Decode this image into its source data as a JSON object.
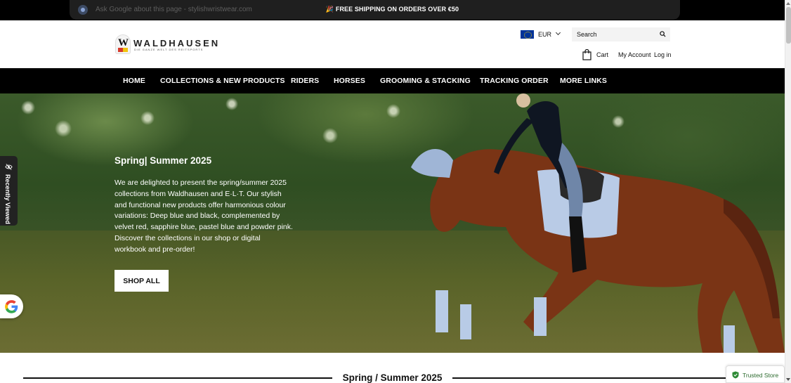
{
  "announcement": {
    "text": "🎉 FREE SHIPPING ON ORDERS OVER €50",
    "google_overlay": "Ask Google about this page - stylishwristwear.com"
  },
  "header": {
    "logo_word": "WALDHAUSEN",
    "logo_tagline": "DIE GANZE WELT DES REITSPORTS",
    "currency": "EUR",
    "search_placeholder": "Search",
    "cart_label": "Cart",
    "account_label": "My Account",
    "login_label": "Log in"
  },
  "nav": {
    "items": [
      {
        "label": "HOME"
      },
      {
        "label": "COLLECTIONS & NEW PRODUCTS"
      },
      {
        "label": "RIDERS"
      },
      {
        "label": "HORSES"
      },
      {
        "label": "GROOMING & STACKING"
      },
      {
        "label": "TRACKING ORDER"
      },
      {
        "label": "MORE LINKS"
      }
    ]
  },
  "hero": {
    "title": "Spring| Summer 2025",
    "body": "We are delighted to present the spring/summer 2025 collections from Waldhausen and E·L·T. Our stylish and functional new products offer harmonious colour variations: Deep blue and black, complemented by velvet red, sapphire blue, pastel blue and powder pink. Discover the collections in our shop or digital workbook and pre-order!",
    "button": "SHOP ALL"
  },
  "side": {
    "recently_viewed": "Recently Viewed"
  },
  "section": {
    "title": "Spring / Summer 2025"
  },
  "trusted": {
    "label": "Trusted Store"
  },
  "colors": {
    "bar": "#000000",
    "accent_green": "#2d8a35",
    "eu_blue": "#003399"
  }
}
